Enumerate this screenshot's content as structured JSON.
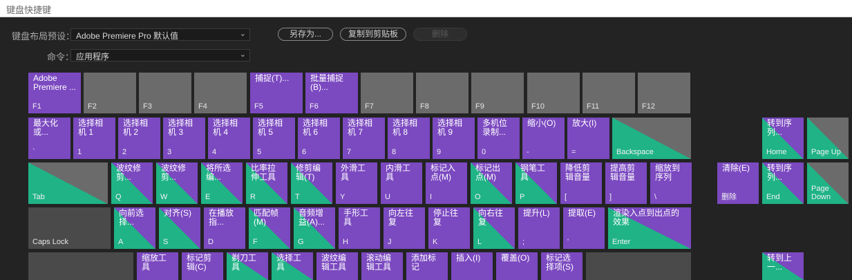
{
  "window": {
    "title": "键盘快捷键"
  },
  "preset": {
    "label": "键盘布局预设：",
    "value": "Adobe Premiere Pro 默认值"
  },
  "command": {
    "label": "命令：",
    "value": "应用程序"
  },
  "actions": {
    "save_as": "另存为...",
    "copy_to_clipboard": "复制到剪贴板",
    "delete": "删除"
  },
  "icons": {
    "dropdown": "chevron-down-icon"
  },
  "colors": {
    "assigned": "#7b49c0",
    "modifier_assigned": "#1fb386",
    "unassigned": "#6b6b6b",
    "background": "#232323"
  },
  "keys": [
    {
      "cap": "F1",
      "cmd": "Adobe\nPremiere ...",
      "s": "purple"
    },
    {
      "cap": "F2",
      "cmd": "",
      "s": "gray"
    },
    {
      "cap": "F3",
      "cmd": "",
      "s": "gray"
    },
    {
      "cap": "F4",
      "cmd": "",
      "s": "gray"
    },
    {
      "cap": "F5",
      "cmd": "捕捉(T)...",
      "s": "purple"
    },
    {
      "cap": "F6",
      "cmd": "批量捕捉\n(B)...",
      "s": "purple"
    },
    {
      "cap": "F7",
      "cmd": "",
      "s": "gray"
    },
    {
      "cap": "F8",
      "cmd": "",
      "s": "gray"
    },
    {
      "cap": "F9",
      "cmd": "",
      "s": "gray"
    },
    {
      "cap": "F10",
      "cmd": "",
      "s": "gray"
    },
    {
      "cap": "F11",
      "cmd": "",
      "s": "gray"
    },
    {
      "cap": "F12",
      "cmd": "",
      "s": "gray"
    },
    {
      "cap": "`",
      "cmd": "最大化\n或...",
      "s": "purple"
    },
    {
      "cap": "1",
      "cmd": "选择相\n机 1",
      "s": "purple"
    },
    {
      "cap": "2",
      "cmd": "选择相\n机 2",
      "s": "purple"
    },
    {
      "cap": "3",
      "cmd": "选择相\n机 3",
      "s": "purple"
    },
    {
      "cap": "4",
      "cmd": "选择相\n机 4",
      "s": "purple"
    },
    {
      "cap": "5",
      "cmd": "选择相\n机 5",
      "s": "purple"
    },
    {
      "cap": "6",
      "cmd": "选择相\n机 6",
      "s": "purple"
    },
    {
      "cap": "7",
      "cmd": "选择相\n机 7",
      "s": "purple"
    },
    {
      "cap": "8",
      "cmd": "选择相\n机 8",
      "s": "purple"
    },
    {
      "cap": "9",
      "cmd": "选择相\n机 9",
      "s": "purple"
    },
    {
      "cap": "0",
      "cmd": "多机位\n录制...",
      "s": "purple"
    },
    {
      "cap": "-",
      "cmd": "缩小(O)",
      "s": "purple"
    },
    {
      "cap": "=",
      "cmd": "放大(I)",
      "s": "purple"
    },
    {
      "cap": "Backspace",
      "cmd": "",
      "s": "split-pg"
    },
    {
      "cap": "Tab",
      "cmd": "",
      "s": "split-pg"
    },
    {
      "cap": "Q",
      "cmd": "波纹修\n剪...",
      "s": "split-gp"
    },
    {
      "cap": "W",
      "cmd": "波纹修\n剪...",
      "s": "split-gp"
    },
    {
      "cap": "E",
      "cmd": "将所选\n编...",
      "s": "split-gp"
    },
    {
      "cap": "R",
      "cmd": "比率拉\n伸工具",
      "s": "split-gp"
    },
    {
      "cap": "T",
      "cmd": "修剪编\n辑(T)",
      "s": "split-gp"
    },
    {
      "cap": "Y",
      "cmd": "外滑工\n具",
      "s": "purple"
    },
    {
      "cap": "U",
      "cmd": "内滑工\n具",
      "s": "purple"
    },
    {
      "cap": "I",
      "cmd": "标记入\n点(M)",
      "s": "purple"
    },
    {
      "cap": "O",
      "cmd": "标记出\n点(M)",
      "s": "split-gp"
    },
    {
      "cap": "P",
      "cmd": "钢笔工\n具",
      "s": "split-gp"
    },
    {
      "cap": "[",
      "cmd": "降低剪\n辑音量",
      "s": "purple"
    },
    {
      "cap": "]",
      "cmd": "提高剪\n辑音量",
      "s": "purple"
    },
    {
      "cap": "\\",
      "cmd": "缩放到\n序列",
      "s": "purple"
    },
    {
      "cap": "Caps Lock",
      "cmd": "",
      "s": "dark"
    },
    {
      "cap": "A",
      "cmd": "向前选\n择...",
      "s": "split-gp"
    },
    {
      "cap": "S",
      "cmd": "对齐(S)",
      "s": "split-gp"
    },
    {
      "cap": "D",
      "cmd": "在播放\n指...",
      "s": "purple"
    },
    {
      "cap": "F",
      "cmd": "匹配帧\n(M)",
      "s": "split-gp"
    },
    {
      "cap": "G",
      "cmd": "音频增\n益(A)...",
      "s": "split-gp"
    },
    {
      "cap": "H",
      "cmd": "手形工\n具",
      "s": "purple"
    },
    {
      "cap": "J",
      "cmd": "向左往\n复",
      "s": "purple"
    },
    {
      "cap": "K",
      "cmd": "停止往\n复",
      "s": "purple"
    },
    {
      "cap": "L",
      "cmd": "向右往\n复",
      "s": "split-gp"
    },
    {
      "cap": ";",
      "cmd": "提升(L)",
      "s": "purple"
    },
    {
      "cap": "'",
      "cmd": "提取(E)",
      "s": "purple"
    },
    {
      "cap": "Enter",
      "cmd": "渲染入点到出点的\n效果",
      "s": "split-gp"
    },
    {
      "cap": "",
      "cmd": "",
      "s": "dark"
    },
    {
      "cap": "",
      "cmd": "缩放工\n具",
      "s": "purple"
    },
    {
      "cap": "",
      "cmd": "标记剪\n辑(C)",
      "s": "purple"
    },
    {
      "cap": "",
      "cmd": "剃刀工\n具",
      "s": "split-gp"
    },
    {
      "cap": "",
      "cmd": "选择工\n具",
      "s": "split-gp"
    },
    {
      "cap": "",
      "cmd": "波纹编\n辑工具",
      "s": "purple"
    },
    {
      "cap": "",
      "cmd": "滚动编\n辑工具",
      "s": "purple"
    },
    {
      "cap": "",
      "cmd": "添加标\n记",
      "s": "purple"
    },
    {
      "cap": "",
      "cmd": "插入(I)",
      "s": "purple"
    },
    {
      "cap": "",
      "cmd": "覆盖(O)",
      "s": "purple"
    },
    {
      "cap": "",
      "cmd": "标记选\n择项(S)",
      "s": "purple"
    },
    {
      "cap": "",
      "cmd": "",
      "s": "dark"
    },
    {
      "cap": "Home",
      "cmd": "转到序\n列...",
      "s": "split-gp"
    },
    {
      "cap": "Page Up",
      "cmd": "",
      "s": "split-pg"
    },
    {
      "cap": "删除",
      "cmd": "清除(E)",
      "s": "purple"
    },
    {
      "cap": "End",
      "cmd": "转到序\n列...",
      "s": "split-gp"
    },
    {
      "cap": "Page\nDown",
      "cmd": "",
      "s": "split-pg"
    },
    {
      "cap": "",
      "cmd": "转到上\n一...",
      "s": "split-gp"
    }
  ]
}
